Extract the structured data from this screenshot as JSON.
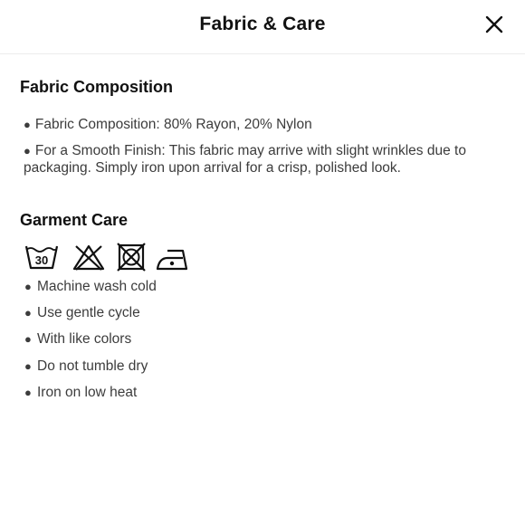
{
  "header": {
    "title": "Fabric & Care",
    "close_icon": "close-icon"
  },
  "composition": {
    "title": "Fabric Composition",
    "items": [
      "Fabric Composition: 80% Rayon, 20% Nylon",
      "For a Smooth Finish: This fabric may arrive with slight wrinkles due to packaging. Simply iron upon arrival for a crisp, polished look."
    ]
  },
  "care": {
    "title": "Garment Care",
    "icons": [
      {
        "name": "wash-30-icon",
        "label": "30"
      },
      {
        "name": "do-not-bleach-icon"
      },
      {
        "name": "do-not-tumble-dry-icon"
      },
      {
        "name": "iron-low-heat-icon"
      }
    ],
    "items": [
      "Machine wash cold",
      "Use gentle cycle",
      "With like colors",
      "Do not tumble dry",
      "Iron on low heat"
    ]
  }
}
